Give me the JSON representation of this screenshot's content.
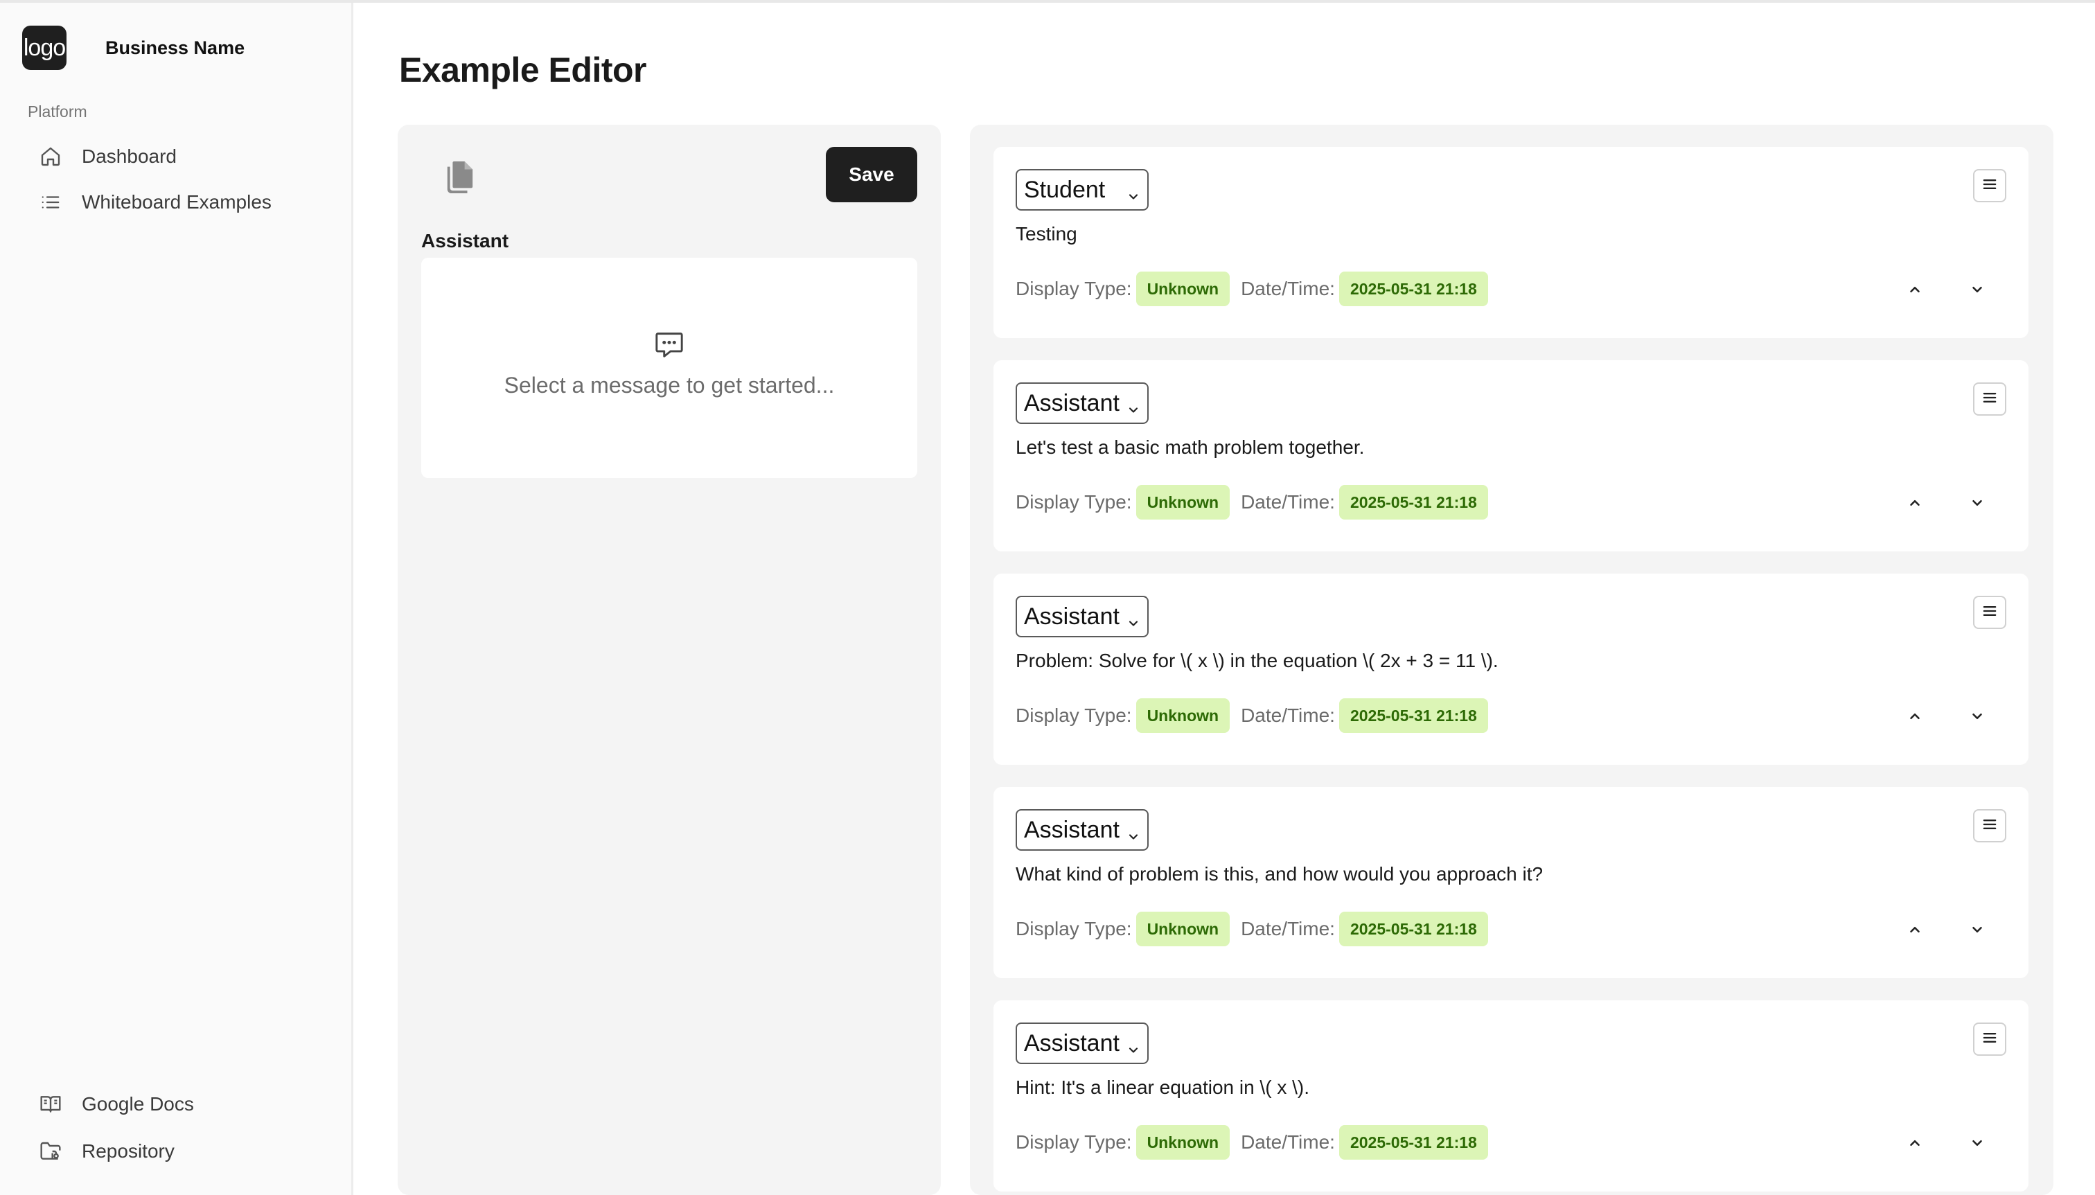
{
  "sidebar": {
    "logo_text": "logo",
    "business_name": "Business Name",
    "section_label": "Platform",
    "items": [
      {
        "label": "Dashboard",
        "icon": "home-icon"
      },
      {
        "label": "Whiteboard Examples",
        "icon": "list-icon"
      }
    ],
    "footer_items": [
      {
        "label": "Google Docs",
        "icon": "book-icon"
      },
      {
        "label": "Repository",
        "icon": "folder-git-icon"
      }
    ]
  },
  "page": {
    "title": "Example Editor"
  },
  "editor": {
    "copy_icon": "copy-icon",
    "save_label": "Save",
    "panel_label": "Assistant",
    "empty_icon": "message-icon",
    "empty_text": "Select a message to get started..."
  },
  "messages": {
    "display_type_label": "Display Type:",
    "datetime_label": "Date/Time:",
    "items": [
      {
        "role": "Student",
        "text": "Testing",
        "display_type": "Unknown",
        "datetime": "2025-05-31 21:18"
      },
      {
        "role": "Assistant",
        "text": "Let's test a basic math problem together.",
        "display_type": "Unknown",
        "datetime": "2025-05-31 21:18"
      },
      {
        "role": "Assistant",
        "text": "Problem: Solve for \\( x \\) in the equation \\( 2x + 3 = 11 \\).",
        "display_type": "Unknown",
        "datetime": "2025-05-31 21:18"
      },
      {
        "role": "Assistant",
        "text": "What kind of problem is this, and how would you approach it?",
        "display_type": "Unknown",
        "datetime": "2025-05-31 21:18"
      },
      {
        "role": "Assistant",
        "text": "Hint: It's a linear equation in \\( x \\).",
        "display_type": "Unknown",
        "datetime": "2025-05-31 21:18"
      }
    ]
  },
  "colors": {
    "badge_bg": "#dcf5b6",
    "badge_text": "#2d6a05",
    "primary_button": "#1f1f1f"
  }
}
